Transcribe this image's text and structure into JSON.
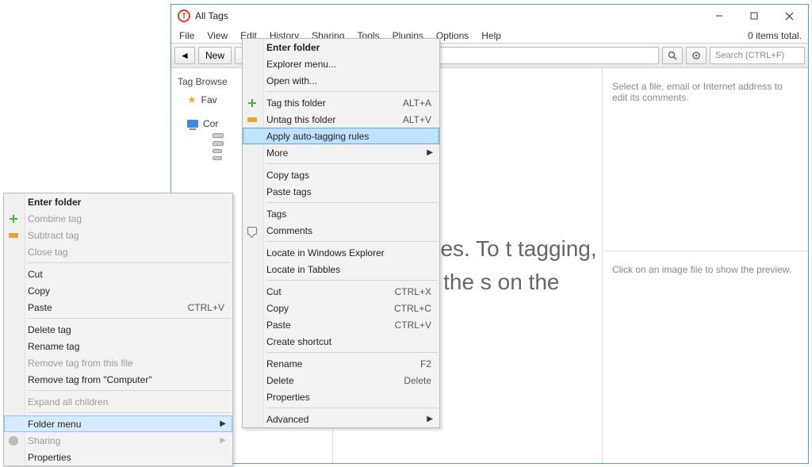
{
  "window": {
    "title": "All Tags",
    "items_total": "0 items total."
  },
  "menubar": [
    "File",
    "View",
    "Edit",
    "History",
    "Sharing",
    "Tools",
    "Plugins",
    "Options",
    "Help"
  ],
  "toolbar": {
    "new_label": "New",
    "search_placeholder": "Search (CTRL+F)"
  },
  "sidebar": {
    "heading": "Tag Browse",
    "favorites": "Fav",
    "computer": "Cor"
  },
  "welcome": {
    "text": "come to bles. To t tagging, one of the s on the"
  },
  "right": {
    "comments_hint": "Select a file, email or Internet address to edit its comments.",
    "preview_hint": "Click on an image file to show the preview."
  },
  "ctx1": {
    "enter_folder": "Enter folder",
    "combine_tag": "Combine tag",
    "subtract_tag": "Subtract tag",
    "close_tag": "Close tag",
    "cut": "Cut",
    "copy": "Copy",
    "paste": "Paste",
    "paste_cut": "CTRL+V",
    "delete_tag": "Delete tag",
    "rename_tag": "Rename tag",
    "remove_from_file": "Remove tag from this file",
    "remove_from_computer": "Remove tag from \"Computer\"",
    "expand_all": "Expand all children",
    "folder_menu": "Folder menu",
    "sharing": "Sharing",
    "properties": "Properties"
  },
  "ctx2": {
    "enter_folder": "Enter folder",
    "explorer_menu": "Explorer menu...",
    "open_with": "Open with...",
    "tag_folder": "Tag this folder",
    "tag_folder_cut": "ALT+A",
    "untag_folder": "Untag this folder",
    "untag_folder_cut": "ALT+V",
    "apply_auto": "Apply auto-tagging rules",
    "more": "More",
    "copy_tags": "Copy tags",
    "paste_tags": "Paste tags",
    "tags": "Tags",
    "comments": "Comments",
    "locate_explorer": "Locate in Windows Explorer",
    "locate_tabbles": "Locate in Tabbles",
    "cut": "Cut",
    "cut_cut": "CTRL+X",
    "copy": "Copy",
    "copy_cut": "CTRL+C",
    "paste": "Paste",
    "paste_cut": "CTRL+V",
    "create_shortcut": "Create shortcut",
    "rename": "Rename",
    "rename_cut": "F2",
    "delete": "Delete",
    "delete_cut": "Delete",
    "properties": "Properties",
    "advanced": "Advanced"
  }
}
